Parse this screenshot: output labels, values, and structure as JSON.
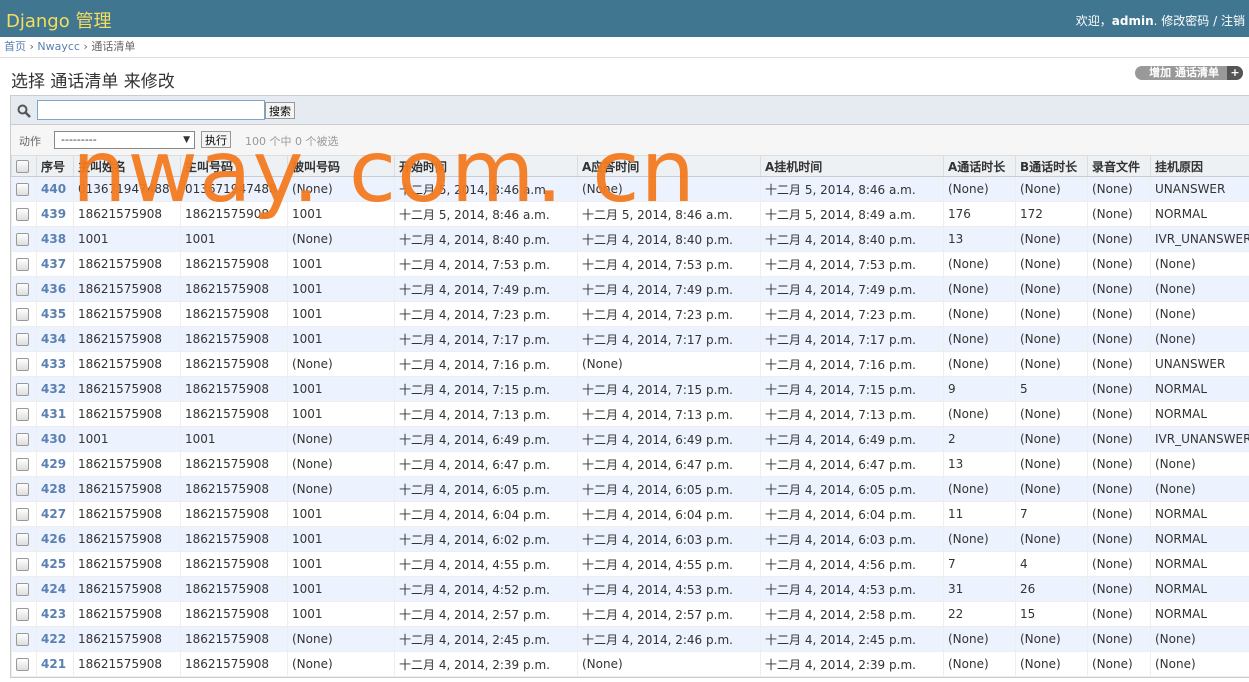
{
  "header": {
    "site_title": "Django 管理",
    "welcome": "欢迎，",
    "username": "admin",
    "change_password": "修改密码",
    "logout": "注销"
  },
  "breadcrumbs": {
    "home": "首页",
    "app": "Nwaycc",
    "current": "通话清单"
  },
  "page_title": "选择 通话清单 来修改",
  "add_button": {
    "label": "增加 通话清单",
    "plus": "+"
  },
  "search": {
    "button": "搜索",
    "value": ""
  },
  "actions": {
    "label": "动作",
    "selected": "---------",
    "go": "执行",
    "counter": "100 个中 0 个被选"
  },
  "watermark": "nway. com. cn",
  "columns": [
    "序号",
    "主叫姓名",
    "主叫号码",
    "被叫号码",
    "开始时间",
    "A应答时间",
    "A挂机时间",
    "A通话时长",
    "B通话时长",
    "录音文件",
    "挂机原因"
  ],
  "rows": [
    [
      "440",
      "013671947488",
      "013671947488",
      "(None)",
      "十二月 5, 2014, 8:46 a.m.",
      "(None)",
      "十二月 5, 2014, 8:46 a.m.",
      "(None)",
      "(None)",
      "(None)",
      "UNANSWER"
    ],
    [
      "439",
      "18621575908",
      "18621575908",
      "1001",
      "十二月 5, 2014, 8:46 a.m.",
      "十二月 5, 2014, 8:46 a.m.",
      "十二月 5, 2014, 8:49 a.m.",
      "176",
      "172",
      "(None)",
      "NORMAL"
    ],
    [
      "438",
      "1001",
      "1001",
      "(None)",
      "十二月 4, 2014, 8:40 p.m.",
      "十二月 4, 2014, 8:40 p.m.",
      "十二月 4, 2014, 8:40 p.m.",
      "13",
      "(None)",
      "(None)",
      "IVR_UNANSWER"
    ],
    [
      "437",
      "18621575908",
      "18621575908",
      "1001",
      "十二月 4, 2014, 7:53 p.m.",
      "十二月 4, 2014, 7:53 p.m.",
      "十二月 4, 2014, 7:53 p.m.",
      "(None)",
      "(None)",
      "(None)",
      "(None)"
    ],
    [
      "436",
      "18621575908",
      "18621575908",
      "1001",
      "十二月 4, 2014, 7:49 p.m.",
      "十二月 4, 2014, 7:49 p.m.",
      "十二月 4, 2014, 7:49 p.m.",
      "(None)",
      "(None)",
      "(None)",
      "(None)"
    ],
    [
      "435",
      "18621575908",
      "18621575908",
      "1001",
      "十二月 4, 2014, 7:23 p.m.",
      "十二月 4, 2014, 7:23 p.m.",
      "十二月 4, 2014, 7:23 p.m.",
      "(None)",
      "(None)",
      "(None)",
      "(None)"
    ],
    [
      "434",
      "18621575908",
      "18621575908",
      "1001",
      "十二月 4, 2014, 7:17 p.m.",
      "十二月 4, 2014, 7:17 p.m.",
      "十二月 4, 2014, 7:17 p.m.",
      "(None)",
      "(None)",
      "(None)",
      "(None)"
    ],
    [
      "433",
      "18621575908",
      "18621575908",
      "(None)",
      "十二月 4, 2014, 7:16 p.m.",
      "(None)",
      "十二月 4, 2014, 7:16 p.m.",
      "(None)",
      "(None)",
      "(None)",
      "UNANSWER"
    ],
    [
      "432",
      "18621575908",
      "18621575908",
      "1001",
      "十二月 4, 2014, 7:15 p.m.",
      "十二月 4, 2014, 7:15 p.m.",
      "十二月 4, 2014, 7:15 p.m.",
      "9",
      "5",
      "(None)",
      "NORMAL"
    ],
    [
      "431",
      "18621575908",
      "18621575908",
      "1001",
      "十二月 4, 2014, 7:13 p.m.",
      "十二月 4, 2014, 7:13 p.m.",
      "十二月 4, 2014, 7:13 p.m.",
      "(None)",
      "(None)",
      "(None)",
      "NORMAL"
    ],
    [
      "430",
      "1001",
      "1001",
      "(None)",
      "十二月 4, 2014, 6:49 p.m.",
      "十二月 4, 2014, 6:49 p.m.",
      "十二月 4, 2014, 6:49 p.m.",
      "2",
      "(None)",
      "(None)",
      "IVR_UNANSWER"
    ],
    [
      "429",
      "18621575908",
      "18621575908",
      "(None)",
      "十二月 4, 2014, 6:47 p.m.",
      "十二月 4, 2014, 6:47 p.m.",
      "十二月 4, 2014, 6:47 p.m.",
      "13",
      "(None)",
      "(None)",
      "(None)"
    ],
    [
      "428",
      "18621575908",
      "18621575908",
      "(None)",
      "十二月 4, 2014, 6:05 p.m.",
      "十二月 4, 2014, 6:05 p.m.",
      "十二月 4, 2014, 6:05 p.m.",
      "(None)",
      "(None)",
      "(None)",
      "(None)"
    ],
    [
      "427",
      "18621575908",
      "18621575908",
      "1001",
      "十二月 4, 2014, 6:04 p.m.",
      "十二月 4, 2014, 6:04 p.m.",
      "十二月 4, 2014, 6:04 p.m.",
      "11",
      "7",
      "(None)",
      "NORMAL"
    ],
    [
      "426",
      "18621575908",
      "18621575908",
      "1001",
      "十二月 4, 2014, 6:02 p.m.",
      "十二月 4, 2014, 6:03 p.m.",
      "十二月 4, 2014, 6:03 p.m.",
      "(None)",
      "(None)",
      "(None)",
      "NORMAL"
    ],
    [
      "425",
      "18621575908",
      "18621575908",
      "1001",
      "十二月 4, 2014, 4:55 p.m.",
      "十二月 4, 2014, 4:55 p.m.",
      "十二月 4, 2014, 4:56 p.m.",
      "7",
      "4",
      "(None)",
      "NORMAL"
    ],
    [
      "424",
      "18621575908",
      "18621575908",
      "1001",
      "十二月 4, 2014, 4:52 p.m.",
      "十二月 4, 2014, 4:53 p.m.",
      "十二月 4, 2014, 4:53 p.m.",
      "31",
      "26",
      "(None)",
      "NORMAL"
    ],
    [
      "423",
      "18621575908",
      "18621575908",
      "1001",
      "十二月 4, 2014, 2:57 p.m.",
      "十二月 4, 2014, 2:57 p.m.",
      "十二月 4, 2014, 2:58 p.m.",
      "22",
      "15",
      "(None)",
      "NORMAL"
    ],
    [
      "422",
      "18621575908",
      "18621575908",
      "(None)",
      "十二月 4, 2014, 2:45 p.m.",
      "十二月 4, 2014, 2:46 p.m.",
      "十二月 4, 2014, 2:45 p.m.",
      "(None)",
      "(None)",
      "(None)",
      "(None)"
    ],
    [
      "421",
      "18621575908",
      "18621575908",
      "(None)",
      "十二月 4, 2014, 2:39 p.m.",
      "(None)",
      "十二月 4, 2014, 2:39 p.m.",
      "(None)",
      "(None)",
      "(None)",
      "(None)"
    ]
  ]
}
